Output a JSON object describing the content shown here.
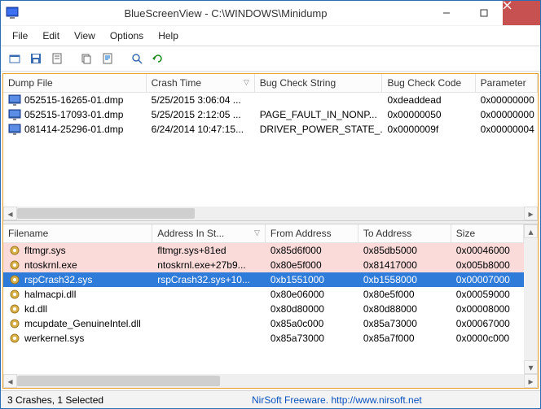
{
  "title": "BlueScreenView  -  C:\\WINDOWS\\Minidump",
  "menu": [
    "File",
    "Edit",
    "View",
    "Options",
    "Help"
  ],
  "top_table": {
    "headers": [
      "Dump File",
      "Crash Time",
      "Bug Check String",
      "Bug Check Code",
      "Parameter"
    ],
    "sort_col": 1,
    "rows": [
      {
        "file": "052515-16265-01.dmp",
        "time": "5/25/2015 3:06:04 ...",
        "bug": "",
        "code": "0xdeaddead",
        "param": "0x00000000"
      },
      {
        "file": "052515-17093-01.dmp",
        "time": "5/25/2015 2:12:05 ...",
        "bug": "PAGE_FAULT_IN_NONP...",
        "code": "0x00000050",
        "param": "0x00000000"
      },
      {
        "file": "081414-25296-01.dmp",
        "time": "6/24/2014 10:47:15...",
        "bug": "DRIVER_POWER_STATE_...",
        "code": "0x0000009f",
        "param": "0x00000004"
      }
    ]
  },
  "bottom_table": {
    "headers": [
      "Filename",
      "Address In St...",
      "From Address",
      "To Address",
      "Size"
    ],
    "sort_col": 1,
    "rows": [
      {
        "fn": "fltmgr.sys",
        "addr": "fltmgr.sys+81ed",
        "from": "0x85d6f000",
        "to": "0x85db5000",
        "size": "0x00046000",
        "hl": "pink"
      },
      {
        "fn": "ntoskrnl.exe",
        "addr": "ntoskrnl.exe+27b9...",
        "from": "0x80e5f000",
        "to": "0x81417000",
        "size": "0x005b8000",
        "hl": "pink"
      },
      {
        "fn": "rspCrash32.sys",
        "addr": "rspCrash32.sys+10...",
        "from": "0xb1551000",
        "to": "0xb1558000",
        "size": "0x00007000",
        "hl": "selected"
      },
      {
        "fn": "halmacpi.dll",
        "addr": "",
        "from": "0x80e06000",
        "to": "0x80e5f000",
        "size": "0x00059000"
      },
      {
        "fn": "kd.dll",
        "addr": "",
        "from": "0x80d80000",
        "to": "0x80d88000",
        "size": "0x00008000"
      },
      {
        "fn": "mcupdate_GenuineIntel.dll",
        "addr": "",
        "from": "0x85a0c000",
        "to": "0x85a73000",
        "size": "0x00067000"
      },
      {
        "fn": "werkernel.sys",
        "addr": "",
        "from": "0x85a73000",
        "to": "0x85a7f000",
        "size": "0x0000c000"
      }
    ]
  },
  "status_left": "3 Crashes, 1 Selected",
  "status_brand": "NirSoft Freeware.  ",
  "status_link": "http://www.nirsoft.net"
}
